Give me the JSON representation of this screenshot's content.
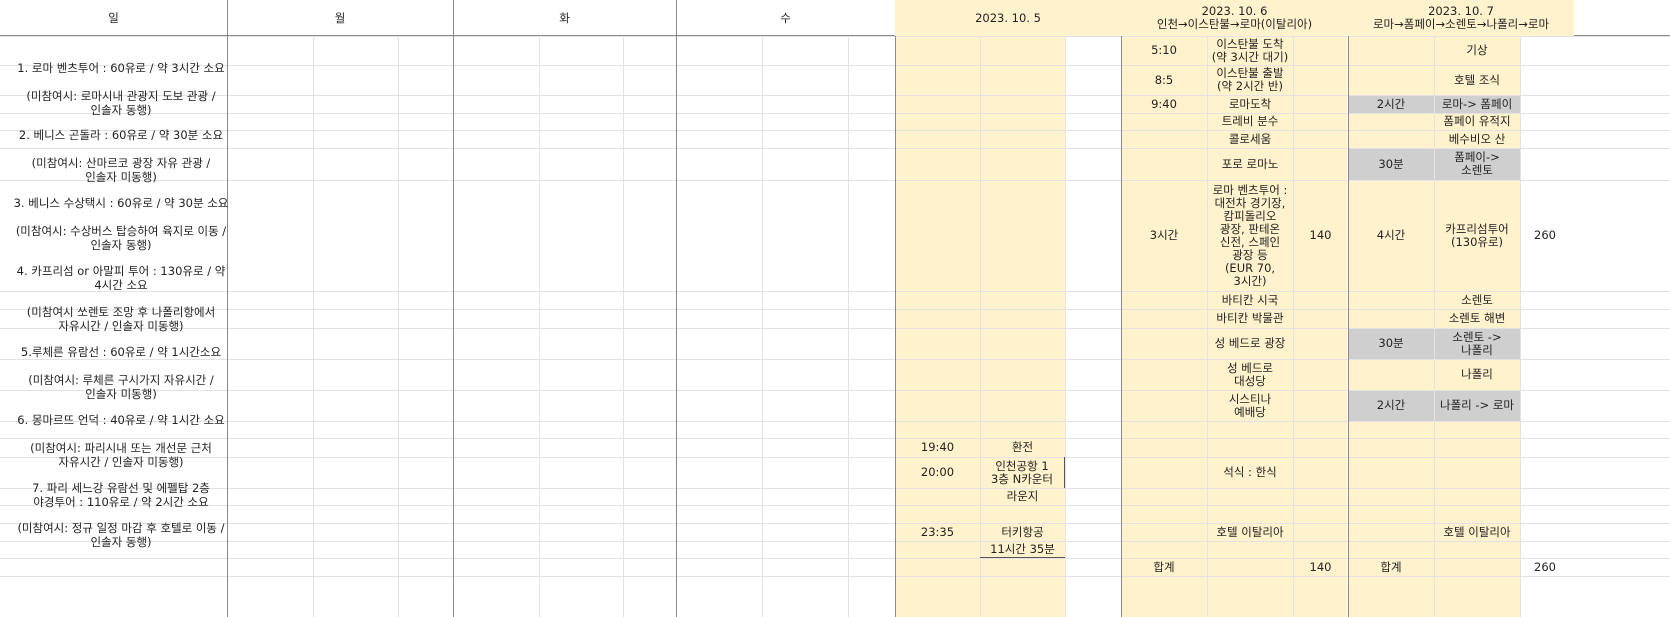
{
  "header": {
    "sun": "일",
    "mon": "월",
    "tue": "화",
    "wed": "수",
    "thu_date": "2023. 10. 5",
    "fri_date": "2023. 10. 6",
    "fri_route": "인천→이스탄불→로마(이탈리아)",
    "sat_date": "2023. 10. 7",
    "sat_route": "로마→폼페이→소렌토→나폴리→로마"
  },
  "notes": [
    [
      "1. 로마 벤츠투어 : 60유로 / 약 3시간 소요"
    ],
    [
      "(미참여시: 로마시내 관광지 도보 관광 /",
      "인솔자 동행)"
    ],
    [
      "2. 베니스 곤돌라 : 60유로 / 약 30분 소요"
    ],
    [
      "(미참여시: 산마르코 광장 자유 관광 /",
      "인솔자 미동행)"
    ],
    [
      "3. 베니스 수상택시 : 60유로 / 약 30분 소요"
    ],
    [
      "(미참여시: 수상버스 탑승하여 육지로 이동 /",
      "인솔자 동행)"
    ],
    [
      "4. 카프리섬 or 아말피 투어 : 130유로 / 약",
      "4시간 소요"
    ],
    [
      "(미참여시 쏘렌토 조망 후 나폴리항에서",
      "자유시간 / 인솔자 미동행)"
    ],
    [
      "5.루체른 유람선 : 60유로 / 약 1시간소요"
    ],
    [
      "(미참여시: 루체른 구시가지 자유시간 /",
      "인솔자 미동행)"
    ],
    [
      "6. 몽마르뜨 언덕 : 40유로 / 약 1시간 소요"
    ],
    [
      "(미참여시: 파리시내 또는 개선문 근처",
      "자유시간 / 인솔자 미동행)"
    ],
    [
      "7. 파리 세느강 유람선 및 에펠탑 2층",
      "야경투어 : 110유로 / 약 2시간 소요"
    ],
    [
      "(미참여시: 정규 일정 마감 후 호텔로 이동 /",
      "인솔자 동행)"
    ]
  ],
  "thu": {
    "rows": [
      {
        "time": "19:40",
        "item": [
          "환전"
        ]
      },
      {
        "time": "20:00",
        "item": [
          "인천공항 1",
          "3층 N카운터"
        ]
      },
      {
        "time": "",
        "item": [
          "라운지"
        ]
      },
      {
        "time": "23:35",
        "item": [
          "터키항공"
        ]
      },
      {
        "time": "",
        "item": [
          "11시간 35분"
        ]
      }
    ]
  },
  "fri": {
    "rows": [
      {
        "time": "5:10",
        "item": [
          "이스탄불 도착",
          "(약 3시간 대기)"
        ],
        "cost": ""
      },
      {
        "time": "8:5",
        "item": [
          "이스탄불 출발",
          "(약 2시간 반)"
        ],
        "cost": ""
      },
      {
        "time": "9:40",
        "item": [
          "로마도착"
        ],
        "cost": ""
      },
      {
        "time": "",
        "item": [
          "트레비 분수"
        ],
        "cost": ""
      },
      {
        "time": "",
        "item": [
          "콜로세움"
        ],
        "cost": ""
      },
      {
        "time": "",
        "item": [
          "포로 로마노"
        ],
        "cost": ""
      },
      {
        "time": "3시간",
        "item": [
          "로마 벤츠투어 :",
          "대전차 경기장,",
          "캄피돌리오",
          "광장, 판테온",
          "신전, 스페인",
          "광장 등",
          "(EUR 70,",
          "3시간)"
        ],
        "cost": "140"
      },
      {
        "time": "",
        "item": [
          "바티칸 시국"
        ],
        "cost": ""
      },
      {
        "time": "",
        "item": [
          "바티칸 박물관"
        ],
        "cost": ""
      },
      {
        "time": "",
        "item": [
          "성 베드로 광장"
        ],
        "cost": ""
      },
      {
        "time": "",
        "item": [
          "성 베드로",
          "대성당"
        ],
        "cost": ""
      },
      {
        "time": "",
        "item": [
          "시스티나",
          "예배당"
        ],
        "cost": ""
      },
      {
        "time": "",
        "item": [
          "석식 : 한식"
        ],
        "cost": ""
      },
      {
        "time": "",
        "item": [
          "호텔 이탈리아"
        ],
        "cost": ""
      }
    ],
    "total_label": "합계",
    "total_value": "140"
  },
  "sat": {
    "rows": [
      {
        "time": "",
        "item": [
          "기상"
        ],
        "cost": ""
      },
      {
        "time": "",
        "item": [
          "호텔 조식"
        ],
        "cost": ""
      },
      {
        "time": "2시간",
        "item": [
          "로마-> 폼페이"
        ],
        "cost": ""
      },
      {
        "time": "",
        "item": [
          "폼페이 유적지"
        ],
        "cost": ""
      },
      {
        "time": "",
        "item": [
          "베수비오 산"
        ],
        "cost": ""
      },
      {
        "time": "30분",
        "item": [
          "폼페이->",
          "소렌토"
        ],
        "cost": ""
      },
      {
        "time": "4시간",
        "item": [
          "카프리섬투어",
          "(130유로)"
        ],
        "cost": "260"
      },
      {
        "time": "",
        "item": [
          "소렌토"
        ],
        "cost": ""
      },
      {
        "time": "",
        "item": [
          "소렌토 해변"
        ],
        "cost": ""
      },
      {
        "time": "30분",
        "item": [
          "소렌토 ->",
          "나폴리"
        ],
        "cost": ""
      },
      {
        "time": "",
        "item": [
          "나폴리"
        ],
        "cost": ""
      },
      {
        "time": "2시간",
        "item": [
          "나폴리 -> 로마"
        ],
        "cost": ""
      },
      {
        "time": "",
        "item": [
          "호텔 이탈리아"
        ],
        "cost": ""
      }
    ],
    "total_label": "합계",
    "total_value": "260"
  },
  "colors": {
    "highlight": "#fff2cc",
    "transport": "#cfcfcf",
    "grid": "#e3e3e3",
    "border": "#8a8a8a"
  }
}
